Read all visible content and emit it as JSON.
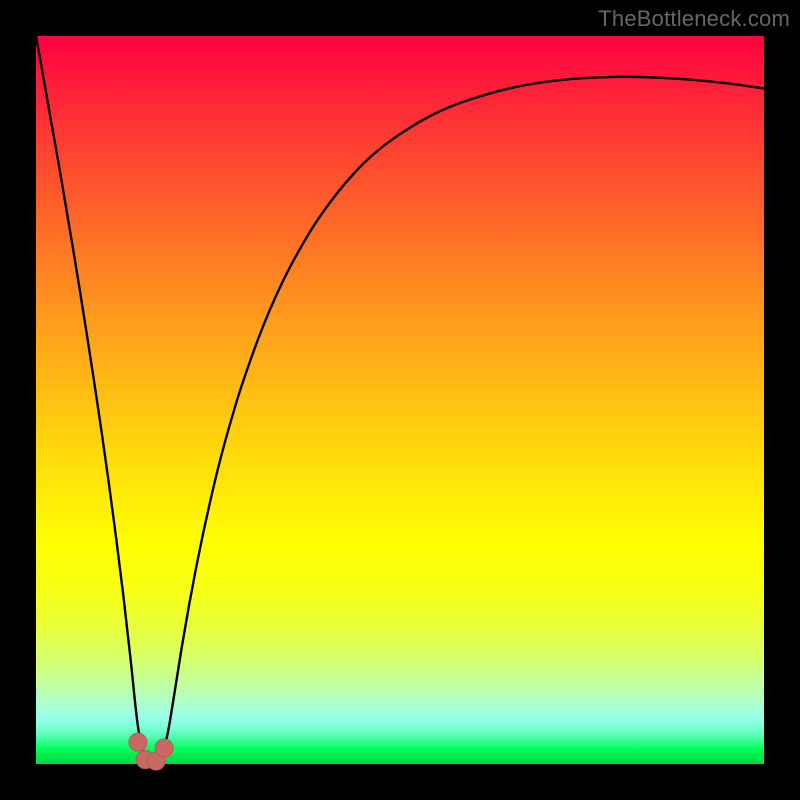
{
  "watermark": "TheBottleneck.com",
  "colors": {
    "frame": "#000000",
    "gradient_top": "#ff0040",
    "gradient_bottom": "#00d847",
    "curve_stroke": "#000000",
    "marker_fill": "#c86a64",
    "marker_stroke": "#b55a55"
  },
  "chart_data": {
    "type": "line",
    "title": "",
    "xlabel": "",
    "ylabel": "",
    "xlim": [
      0,
      100
    ],
    "ylim": [
      0,
      100
    ],
    "x": [
      0,
      1,
      2,
      3,
      4,
      5,
      6,
      7,
      8,
      9,
      10,
      11,
      12,
      13,
      14,
      15,
      16,
      17,
      18,
      19,
      20,
      21,
      22,
      23,
      24,
      25,
      26,
      27,
      28,
      30,
      32,
      34,
      36,
      38,
      40,
      42,
      45,
      48,
      52,
      56,
      60,
      65,
      70,
      75,
      80,
      85,
      90,
      95,
      100
    ],
    "y": [
      100,
      94.4,
      88.7,
      83.1,
      77.2,
      71.3,
      65.2,
      58.9,
      52.4,
      45.7,
      38.6,
      31.1,
      23.1,
      14.3,
      5.2,
      0.8,
      0.2,
      0.9,
      3.8,
      9.6,
      15.9,
      21.7,
      27.0,
      31.9,
      36.4,
      40.6,
      44.4,
      47.9,
      51.2,
      57.0,
      62.1,
      66.5,
      70.3,
      73.7,
      76.6,
      79.2,
      82.5,
      85.1,
      87.8,
      89.9,
      91.4,
      92.8,
      93.7,
      94.2,
      94.4,
      94.3,
      94.0,
      93.5,
      92.8
    ],
    "markers": [
      {
        "x": 14.0,
        "y": 3.0
      },
      {
        "x": 15.0,
        "y": 0.6
      },
      {
        "x": 16.5,
        "y": 0.4
      },
      {
        "x": 17.6,
        "y": 2.2
      }
    ],
    "annotations": []
  }
}
